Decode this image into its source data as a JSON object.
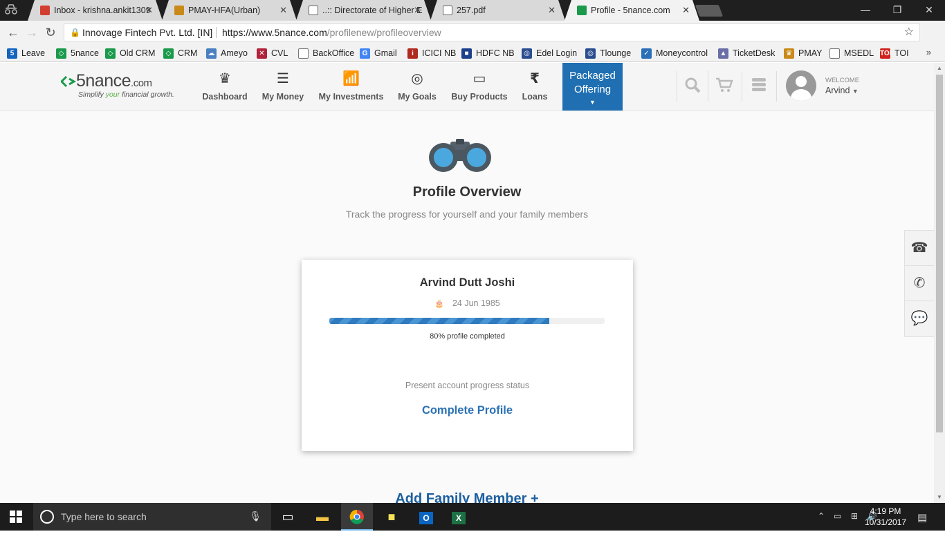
{
  "browser": {
    "tabs": [
      {
        "title": "Inbox - krishna.ankit1309",
        "fav_color": "#d23f31"
      },
      {
        "title": "PMAY-HFA(Urban)",
        "fav_color": "#c98a1a"
      },
      {
        "title": "..:: Directorate of Higher E",
        "fav_color": "#ffffff"
      },
      {
        "title": "257.pdf",
        "fav_color": "#ffffff"
      },
      {
        "title": "Profile - 5nance.com",
        "fav_color": "#1a9a4b"
      }
    ],
    "close_glyph": "✕",
    "window": {
      "minimize": "—",
      "restore": "❐",
      "close": "✕"
    },
    "address": {
      "org": "Innovage Fintech Pvt. Ltd. [IN]",
      "url_host": "https://www.5nance.com",
      "url_path": "/profilenew/profileoverview"
    },
    "bookmarks": [
      {
        "label": "Leave",
        "color": "#1565c0",
        "glyph": "5"
      },
      {
        "label": "5nance",
        "color": "#1a9a4b",
        "glyph": "◇"
      },
      {
        "label": "Old CRM",
        "color": "#1a9a4b",
        "glyph": "◇"
      },
      {
        "label": "CRM",
        "color": "#1a9a4b",
        "glyph": "◇"
      },
      {
        "label": "Ameyo",
        "color": "#4a7fc1",
        "glyph": "☁"
      },
      {
        "label": "CVL",
        "color": "#b0233a",
        "glyph": "✕"
      },
      {
        "label": "BackOffice",
        "color": "#ffffff",
        "glyph": ""
      },
      {
        "label": "Gmail",
        "color": "#4285f4",
        "glyph": "G"
      },
      {
        "label": "ICICI NB",
        "color": "#b02a20",
        "glyph": "i"
      },
      {
        "label": "HDFC NB",
        "color": "#1b3f8b",
        "glyph": "■"
      },
      {
        "label": "Edel Login",
        "color": "#2a4d8f",
        "glyph": "◎"
      },
      {
        "label": "Tlounge",
        "color": "#2a4d8f",
        "glyph": "◎"
      },
      {
        "label": "Moneycontrol",
        "color": "#2a6fb8",
        "glyph": "✓"
      },
      {
        "label": "TicketDesk",
        "color": "#6b6fa8",
        "glyph": "▲"
      },
      {
        "label": "PMAY",
        "color": "#c98a1a",
        "glyph": "♛"
      },
      {
        "label": "MSEDL",
        "color": "#ffffff",
        "glyph": ""
      },
      {
        "label": "TOI",
        "color": "#d0231d",
        "glyph": "TOI"
      }
    ],
    "more": "»"
  },
  "site": {
    "logo": {
      "mark": "<>",
      "name": "5nance",
      "dotcom": ".com",
      "tag_pre": "Simplify ",
      "tag_em": "your",
      "tag_post": " financial growth."
    },
    "nav": [
      {
        "label": "Dashboard",
        "icon": "crown-icon",
        "glyph": "♛"
      },
      {
        "label": "My Money",
        "icon": "coins-icon",
        "glyph": "☰"
      },
      {
        "label": "My Investments",
        "icon": "growth-chart-icon",
        "glyph": "📶"
      },
      {
        "label": "My Goals",
        "icon": "target-icon",
        "glyph": "◎"
      },
      {
        "label": "Buy Products",
        "icon": "card-icon",
        "glyph": "▭"
      },
      {
        "label": "Loans",
        "icon": "rupee-hand-icon",
        "glyph": "₹"
      }
    ],
    "packaged": {
      "line1": "Packaged",
      "line2": "Offering"
    },
    "welcome": "WELCOME",
    "user": "Arvind"
  },
  "overview": {
    "title": "Profile Overview",
    "subtitle": "Track the progress for yourself and your family members",
    "card": {
      "name": "Arvind Dutt Joshi",
      "dob": "24 Jun 1985",
      "progress": 0.8,
      "progress_label": "80% profile completed",
      "status": "Present account progress status",
      "action": "Complete Profile"
    },
    "add_family": "Add Family Member +"
  },
  "taskbar": {
    "search_placeholder": "Type here to search",
    "time": "4:19 PM",
    "date": "10/31/2017"
  }
}
